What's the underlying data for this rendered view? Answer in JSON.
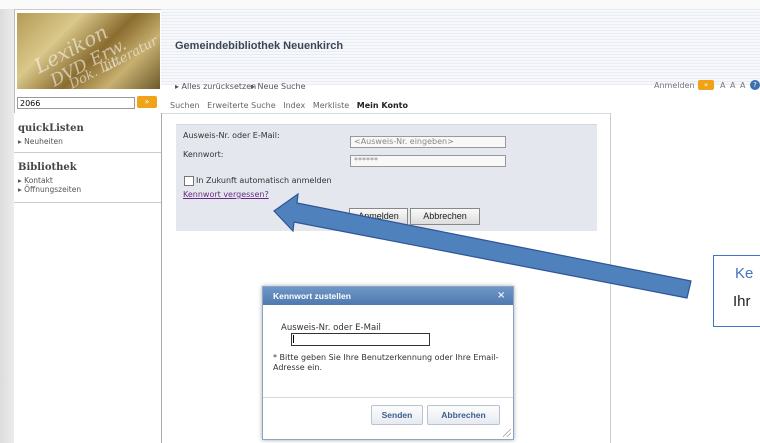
{
  "header": {
    "site_title": "Gemeindebibliothek Neuenkirch",
    "logo_words": [
      "Lexikon",
      "DVD Erw.",
      "Dok. Lit.",
      "Literatur"
    ]
  },
  "search": {
    "value": "2066",
    "go_label": "»"
  },
  "toplinks": {
    "reset": "▸ Alles zurücksetzen",
    "new_search": "▸ Neue Suche",
    "login": "Anmelden",
    "login_go": "»",
    "font_sizes": "A A A",
    "help": "?"
  },
  "tabs": [
    {
      "label": "Suchen",
      "active": false
    },
    {
      "label": "Erweiterte Suche",
      "active": false
    },
    {
      "label": "Index",
      "active": false
    },
    {
      "label": "Merkliste",
      "active": false
    },
    {
      "label": "Mein Konto",
      "active": true
    }
  ],
  "sidebar": {
    "quicklisten": {
      "title": "quickListen",
      "items": [
        "▸ Neuheiten"
      ]
    },
    "bibliothek": {
      "title": "Bibliothek",
      "items": [
        "▸ Kontakt",
        "▸ Öffnungszeiten"
      ]
    }
  },
  "login_form": {
    "id_label": "Ausweis-Nr. oder E-Mail:",
    "id_placeholder": "<Ausweis-Nr. eingeben>",
    "password_label": "Kennwort:",
    "password_value": "******",
    "auto_login_label": "In Zukunft automatisch anmelden",
    "auto_login_checked": false,
    "forgot_link": "Kennwort vergessen?",
    "login_button": "Anmelden",
    "cancel_button": "Abbrechen"
  },
  "dialog": {
    "title": "Kennwort zustellen",
    "close": "×",
    "field_label": "Ausweis-Nr. oder E-Mail",
    "field_value": "",
    "hint": "* Bitte geben Sie Ihre Benutzerkennung oder Ihre Email-Adresse ein.",
    "send_button": "Senden",
    "cancel_button": "Abbrechen"
  },
  "callout": {
    "line1": "Ke",
    "line2": "Ihr",
    "border_color": "#4472c4",
    "arrow_color": "#4f81bd"
  }
}
